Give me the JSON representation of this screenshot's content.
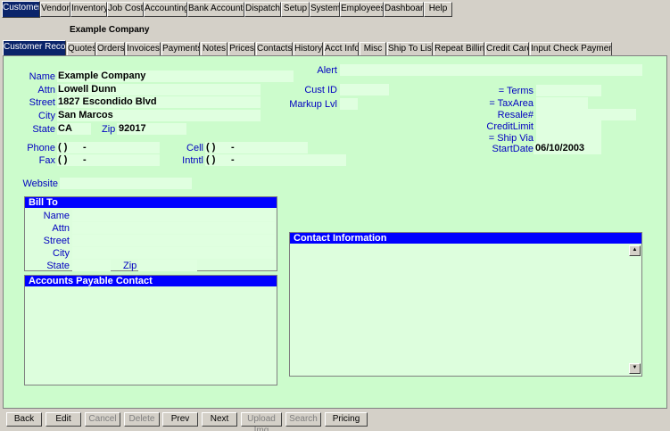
{
  "top_tabs": [
    "Customer",
    "Vendor",
    "Inventory",
    "Job Cost",
    "Accounting",
    "Bank Accounts",
    "Dispatch",
    "Setup",
    "System",
    "Employees",
    "Dashboard",
    "Help"
  ],
  "company_title": "Example Company",
  "sub_tabs": [
    "Customer Record",
    "Quotes",
    "Orders",
    "Invoices",
    "Payments",
    "Notes",
    "Prices",
    "Contacts",
    "History",
    "Acct Info",
    "Misc",
    "Ship To List",
    "Repeat Billing",
    "Credit Cards",
    "Input Check Payments"
  ],
  "labels": {
    "name": "Name",
    "attn": "Attn",
    "street": "Street",
    "city": "City",
    "state": "State",
    "zip": "Zip",
    "phone": "Phone",
    "fax": "Fax",
    "cell": "Cell",
    "intntl": "Intntl",
    "website": "Website",
    "alert": "Alert",
    "cust_id": "Cust ID",
    "markup": "Markup Lvl",
    "terms": "= Terms",
    "taxarea": "= TaxArea",
    "resale": "Resale#",
    "creditlimit": "CreditLimit",
    "shipvia": "= Ship Via",
    "startdate": "StartDate"
  },
  "values": {
    "name": "Example Company",
    "attn": "Lowell Dunn",
    "street": "1827 Escondido Blvd",
    "city": "San Marcos",
    "state": "CA",
    "zip": "92017",
    "phone_paren": "(    )",
    "phone_dash": "-",
    "fax_paren": "(    )",
    "fax_dash": "-",
    "cell_paren": "(    )",
    "cell_dash": "-",
    "intntl_paren": "(    )",
    "intntl_dash": "-",
    "startdate": "06/10/2003"
  },
  "bill_to": {
    "header": "Bill To",
    "labels": {
      "name": "Name",
      "attn": "Attn",
      "street": "Street",
      "city": "City",
      "state": "State",
      "zip": "Zip"
    }
  },
  "ap_contact": {
    "header": "Accounts Payable Contact"
  },
  "contact_info": {
    "header": "Contact Information"
  },
  "buttons": [
    {
      "label": "Back",
      "enabled": true
    },
    {
      "label": "Edit",
      "enabled": true
    },
    {
      "label": "Cancel",
      "enabled": false
    },
    {
      "label": "Delete",
      "enabled": false
    },
    {
      "label": "Prev",
      "enabled": true
    },
    {
      "label": "Next",
      "enabled": true
    },
    {
      "label": "Upload Img",
      "enabled": false
    },
    {
      "label": "Search",
      "enabled": false
    },
    {
      "label": "Pricing",
      "enabled": true
    }
  ],
  "colors": {
    "panel_bg": "#ccfccc",
    "label_blue": "#0000c0",
    "header_blue": "#0000ff",
    "active_tab": "#0a246a"
  }
}
